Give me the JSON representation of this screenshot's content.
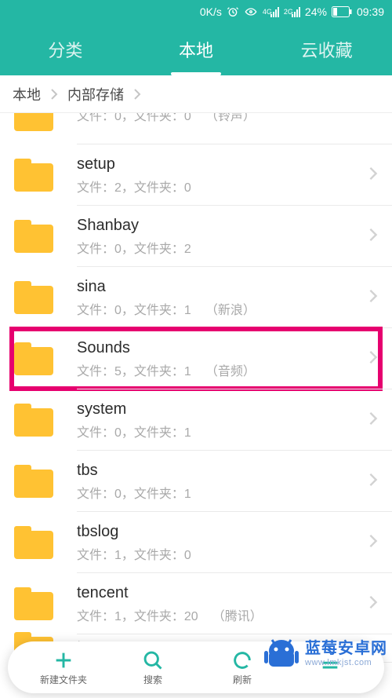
{
  "status": {
    "speed": "0K/s",
    "net1": "4G",
    "net2": "2G",
    "battery": "24%",
    "time": "09:39"
  },
  "tabs": [
    {
      "label": "分类",
      "active": false
    },
    {
      "label": "本地",
      "active": true
    },
    {
      "label": "云收藏",
      "active": false
    }
  ],
  "breadcrumb": [
    {
      "label": "本地"
    },
    {
      "label": "内部存储"
    }
  ],
  "rows": [
    {
      "name": "",
      "files": "0",
      "folders": "0",
      "tag": "（铃声）",
      "partial": "top"
    },
    {
      "name": "setup",
      "files": "2",
      "folders": "0",
      "tag": ""
    },
    {
      "name": "Shanbay",
      "files": "0",
      "folders": "2",
      "tag": ""
    },
    {
      "name": "sina",
      "files": "0",
      "folders": "1",
      "tag": "（新浪）"
    },
    {
      "name": "Sounds",
      "files": "5",
      "folders": "1",
      "tag": "（音频）",
      "highlight": true
    },
    {
      "name": "system",
      "files": "0",
      "folders": "1",
      "tag": ""
    },
    {
      "name": "tbs",
      "files": "0",
      "folders": "1",
      "tag": ""
    },
    {
      "name": "tbslog",
      "files": "1",
      "folders": "0",
      "tag": ""
    },
    {
      "name": "tencent",
      "files": "1",
      "folders": "20",
      "tag": "（腾讯）"
    },
    {
      "name": "tmp",
      "files": "",
      "folders": "",
      "tag": "",
      "partial": "bottom"
    }
  ],
  "meta_labels": {
    "files": "文件：",
    "sep": "，",
    "folders": "文件夹："
  },
  "bottom": [
    {
      "label": "新建文件夹",
      "icon": "plus"
    },
    {
      "label": "搜索",
      "icon": "search"
    },
    {
      "label": "刷新",
      "icon": "refresh"
    }
  ],
  "watermark": {
    "cn": "蓝莓安卓网",
    "url": "www.lmkjst.com"
  }
}
